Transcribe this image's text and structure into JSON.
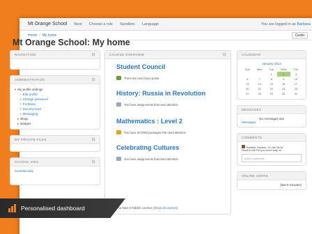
{
  "app": {
    "site_name": "Mt Orange School",
    "menus": [
      "Next",
      "Choose a role",
      "Sandbox",
      "Language"
    ],
    "login_text": "You are logged in as",
    "login_user": "Barbara"
  },
  "navbar": {
    "breadcrumb": [
      "Home",
      "My home"
    ],
    "edit_button": "Custo"
  },
  "page": {
    "title": "Mt Orange School: My home"
  },
  "left": {
    "navigation": {
      "title": "NAVIGATION",
      "control": "⊟"
    },
    "administration": {
      "title": "ADMINISTRATION",
      "control": "⊟",
      "root": "My profile settings",
      "items": [
        "Edit profile",
        "Change password",
        "Portfolios",
        "Security keys",
        "Messaging"
      ],
      "extra": [
        "Blogs",
        "Badges"
      ]
    },
    "private_files": {
      "title": "MY PRIVATE FILES",
      "control": "⊟"
    },
    "school_vids": {
      "title": "SCHOOL VIDS",
      "control": "⊟",
      "item": "Australia Day"
    }
  },
  "overview": {
    "title": "COURSE OVERVIEW",
    "control": "⊟",
    "courses": [
      {
        "name": "Student Council",
        "note": "There are new forum posts",
        "icon_color": "#6a9e3a"
      },
      {
        "name": "History: Russia in Revolution",
        "note": "You have assignments that need attention",
        "icon_color": "#9aa7b8"
      },
      {
        "name": "Mathematics : Level 2",
        "note": "You have SCORM packages that need attention",
        "icon_color": "#e3a323"
      },
      {
        "name": "Celebrating Cultures",
        "note": "You have assignments that need attention",
        "icon_color": "#9aa7b8"
      }
    ],
    "footer_text": "You have 6 hidden courses",
    "footer_link": "(Show all courses)"
  },
  "right": {
    "calendar": {
      "title": "CALENDAR",
      "month": "January 2013",
      "days": [
        "Sun",
        "Mon",
        "Tue",
        "Wed",
        "Thu"
      ],
      "weeks": [
        [
          "",
          "",
          "1",
          "2",
          "3"
        ],
        [
          "6",
          "7",
          "8",
          "9",
          "10"
        ],
        [
          "13",
          "14",
          "15",
          "16",
          "17"
        ],
        [
          "20",
          "21",
          "22",
          "23",
          "24"
        ],
        [
          "27",
          "28",
          "29",
          "30",
          "31"
        ]
      ]
    },
    "messages": {
      "title": "MESSAGES",
      "text": "No messages wai",
      "link": "Messages"
    },
    "comments": {
      "title": "COMMENTS",
      "author": "Barbara Gardner, 24 Jan 16:16",
      "text": "Need to tell Phil you won't stay on",
      "input_placeholder": "Add a comment..."
    },
    "online_users": {
      "title": "ONLINE USERS",
      "text": "(last 5 minutes)"
    }
  },
  "banner": {
    "text": "Personalised dashboard"
  },
  "colors": {
    "accent": "#f07e1e",
    "link": "#2a77c1",
    "banner_bg": "#2d2d2d"
  }
}
